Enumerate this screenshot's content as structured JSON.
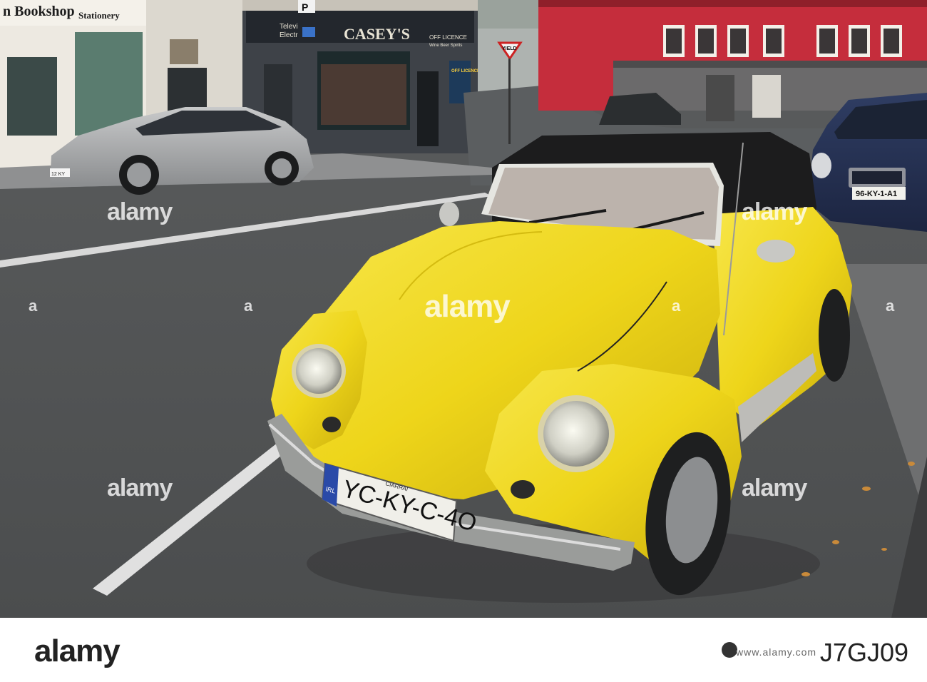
{
  "signs": {
    "bookshop": "n Bookshop",
    "stationery": "Stationery",
    "caseys": "CASEY'S",
    "off_licence": "OFF LICENCE",
    "wine_beer_spirits": "Wine Beer Spirits",
    "tele": "Televi",
    "electr": "Electr",
    "yield": "YIELD",
    "parking": "P",
    "offlicence_board": "OFF LICENCE"
  },
  "car": {
    "plate_country": "IRL",
    "plate_county": "CIARRAI",
    "plate_number": "YC-KY-C-4O",
    "color": "#f2dd1e"
  },
  "honda_plate": "96-KY-1-A1",
  "silver_car_plate": "12 KY",
  "watermark": {
    "text": "alamy",
    "tick": "a"
  },
  "footer": {
    "logo": "alamy",
    "image_id": "J7GJ09",
    "url": "www.alamy.com"
  }
}
